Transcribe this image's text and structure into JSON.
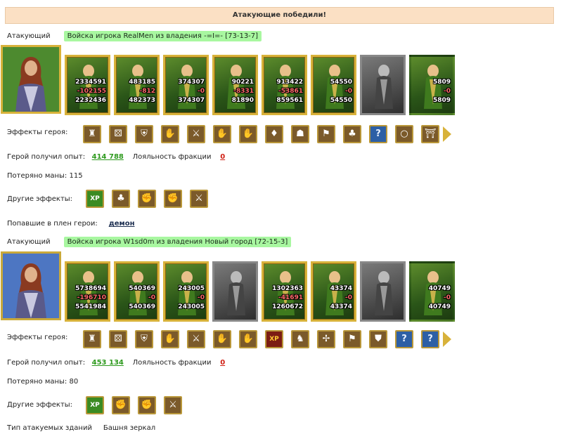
{
  "banner": "Атакующие победили!",
  "sections": [
    {
      "attacker_label": "Атакующий",
      "army_label": "Войска игрока RealMen из владения -=I=- [73-13-7]",
      "units": [
        {
          "n1": "2334591",
          "n2": "-102155",
          "n3": "2232436"
        },
        {
          "n1": "483185",
          "n2": "-812",
          "n3": "482373"
        },
        {
          "n1": "374307",
          "n2": "-0",
          "n3": "374307"
        },
        {
          "n1": "90221",
          "n2": "-8331",
          "n3": "81890"
        },
        {
          "n1": "913422",
          "n2": "-53861",
          "n3": "859561"
        },
        {
          "n1": "54550",
          "n2": "-0",
          "n3": "54550"
        },
        {
          "n1": "",
          "n2": "",
          "n3": ""
        },
        {
          "n1": "5809",
          "n2": "-0",
          "n3": "5809"
        }
      ],
      "effects_label": "Эффекты героя:",
      "effect_icons": [
        "tower-icon",
        "dice-icon",
        "shield-icon",
        "handshake-icon",
        "sword-icon",
        "handshake-icon",
        "hand-icon",
        "bag-icon",
        "helmet-icon",
        "banner-icon",
        "tree-icon",
        "question-icon",
        "ring-icon",
        "gate-icon"
      ],
      "exp_label": "Герой получил опыт:",
      "exp_value": "414 788",
      "loyalty_label": "Лояльность фракции",
      "loyalty_value": "0",
      "mana_text": "Потеряно маны: 115",
      "other_label": "Другие эффекты:",
      "other_icons": [
        "xp-icon",
        "tree-icon",
        "fist-icon",
        "fist-sword-icon",
        "sword-icon"
      ],
      "captured_label": "Попавшие в плен герои:",
      "captured_value": "демон"
    },
    {
      "attacker_label": "Атакующий",
      "army_label": "Войска игрока W1sd0m из владения Новый город [72-15-3]",
      "units": [
        {
          "n1": "5738694",
          "n2": "-196710",
          "n3": "5541984"
        },
        {
          "n1": "540369",
          "n2": "-0",
          "n3": "540369"
        },
        {
          "n1": "243005",
          "n2": "-0",
          "n3": "243005"
        },
        {
          "n1": "",
          "n2": "",
          "n3": ""
        },
        {
          "n1": "1302363",
          "n2": "-41691",
          "n3": "1260672"
        },
        {
          "n1": "43374",
          "n2": "-0",
          "n3": "43374"
        },
        {
          "n1": "",
          "n2": "",
          "n3": ""
        },
        {
          "n1": "40749",
          "n2": "-0",
          "n3": "40749"
        }
      ],
      "effects_label": "Эффекты героя:",
      "effect_icons": [
        "tower-icon",
        "dice-icon",
        "shield-icon",
        "handshake-icon",
        "sword-icon",
        "handshake-icon",
        "hand-icon",
        "xp-icon",
        "xp-horse-icon",
        "wing-icon",
        "banner-icon",
        "armor-icon",
        "question-icon",
        "question-icon"
      ],
      "exp_label": "Герой получил опыт:",
      "exp_value": "453 134",
      "loyalty_label": "Лояльность фракции",
      "loyalty_value": "0",
      "mana_text": "Потеряно маны: 80",
      "other_label": "Другие эффекты:",
      "other_icons": [
        "xp-icon",
        "fist-icon",
        "fist-sword-icon",
        "sword-icon"
      ],
      "building_label": "Тип атакуемых зданий",
      "building_value": "Башня зеркал"
    }
  ],
  "icon_glyphs": {
    "tower-icon": "♜",
    "dice-icon": "⚄",
    "shield-icon": "⛨",
    "handshake-icon": "✋",
    "sword-icon": "⚔",
    "hand-icon": "✋",
    "bag-icon": "♦",
    "helmet-icon": "☗",
    "banner-icon": "⚑",
    "tree-icon": "♣",
    "question-icon": "?",
    "ring-icon": "○",
    "gate-icon": "⛩",
    "xp-icon": "XP",
    "xp-horse-icon": "♞",
    "wing-icon": "✢",
    "armor-icon": "⛊",
    "fist-icon": "✊",
    "fist-sword-icon": "✊"
  },
  "colors": {
    "banner_bg": "#fbe0c4",
    "highlight": "#a8f7a0",
    "gold_frame": "#d8b23a",
    "exp_green": "#2e9a1e",
    "loyalty_red": "#d01e12"
  }
}
